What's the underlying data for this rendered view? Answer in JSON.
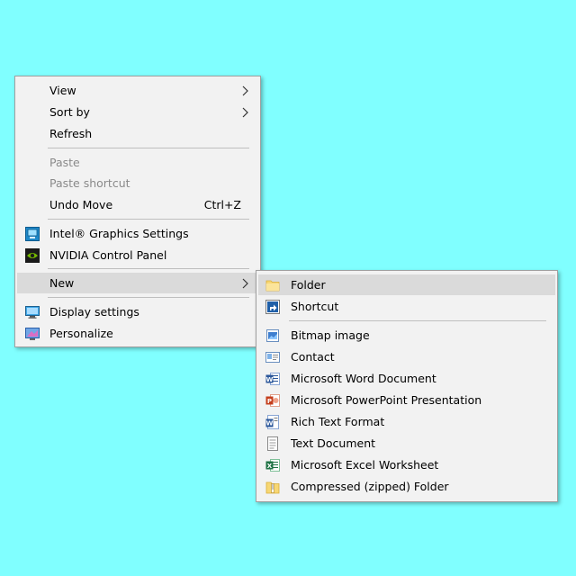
{
  "desktop": {
    "background_color": "#80FFFF"
  },
  "context_menu": {
    "view": "View",
    "sort_by": "Sort by",
    "refresh": "Refresh",
    "paste": "Paste",
    "paste_shortcut": "Paste shortcut",
    "undo_move": "Undo Move",
    "undo_move_shortcut": "Ctrl+Z",
    "intel_graphics": "Intel® Graphics Settings",
    "nvidia_panel": "NVIDIA Control Panel",
    "new": "New",
    "display_settings": "Display settings",
    "personalize": "Personalize"
  },
  "new_submenu": {
    "folder": "Folder",
    "shortcut": "Shortcut",
    "bitmap_image": "Bitmap image",
    "contact": "Contact",
    "word_document": "Microsoft Word Document",
    "powerpoint_presentation": "Microsoft PowerPoint Presentation",
    "rich_text_format": "Rich Text Format",
    "text_document": "Text Document",
    "excel_worksheet": "Microsoft Excel Worksheet",
    "compressed_folder": "Compressed (zipped) Folder"
  },
  "icons": {
    "submenu_arrow": "chevron-right-icon",
    "intel": "intel-graphics-icon",
    "nvidia": "nvidia-icon",
    "display": "display-settings-icon",
    "personalize": "personalize-icon",
    "folder": "folder-icon",
    "shortcut": "shortcut-icon",
    "bitmap": "bitmap-icon",
    "contact": "contact-icon",
    "word": "word-icon",
    "powerpoint": "powerpoint-icon",
    "rtf": "rich-text-icon",
    "text": "text-document-icon",
    "excel": "excel-icon",
    "zip": "zip-folder-icon"
  }
}
